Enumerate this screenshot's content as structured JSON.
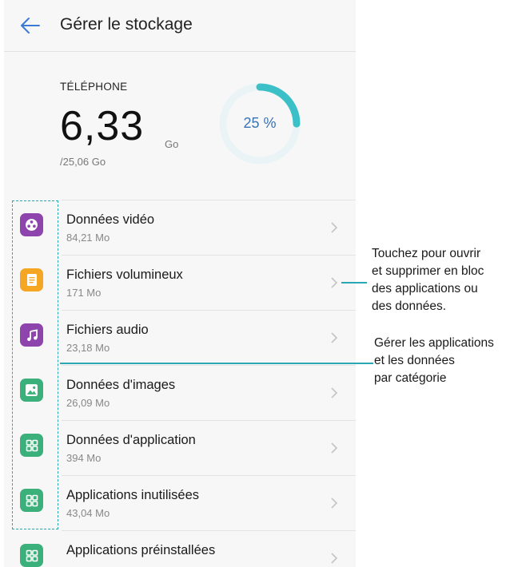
{
  "header": {
    "title": "Gérer le stockage",
    "back_icon": "arrow-left-icon"
  },
  "storage": {
    "label": "TÉLÉPHONE",
    "used": "6,33",
    "unit": "Go",
    "total": "/25,06 Go",
    "percent_text": "25 %",
    "percent": 25,
    "ring_color": "#3cc0c8",
    "ring_track_color": "#eaf4f6"
  },
  "items": [
    {
      "title": "Données vidéo",
      "size": "84,21 Mo",
      "icon": "video-reel-icon",
      "color": "#8e44ad"
    },
    {
      "title": "Fichiers volumineux",
      "size": "171 Mo",
      "icon": "document-icon",
      "color": "#f5a623"
    },
    {
      "title": "Fichiers audio",
      "size": "23,18 Mo",
      "icon": "music-note-icon",
      "color": "#8e44ad"
    },
    {
      "title": "Données d'images",
      "size": "26,09 Mo",
      "icon": "image-icon",
      "color": "#3bb07a"
    },
    {
      "title": "Données d'application",
      "size": "394 Mo",
      "icon": "app-grid-icon",
      "color": "#3bb07a"
    },
    {
      "title": "Applications inutilisées",
      "size": "43,04 Mo",
      "icon": "app-grid-icon",
      "color": "#3bb07a"
    },
    {
      "title": "Applications préinstallées",
      "size": "",
      "icon": "app-grid-icon",
      "color": "#3bb07a"
    }
  ],
  "annotations": {
    "tap_lines": [
      "Touchez pour ouvrir",
      "et supprimer en bloc",
      "des applications ou",
      "des données."
    ],
    "manage_lines": [
      "Gérer les applications",
      "et les données",
      "par catégorie"
    ],
    "line_color": "#2aa7b2"
  }
}
